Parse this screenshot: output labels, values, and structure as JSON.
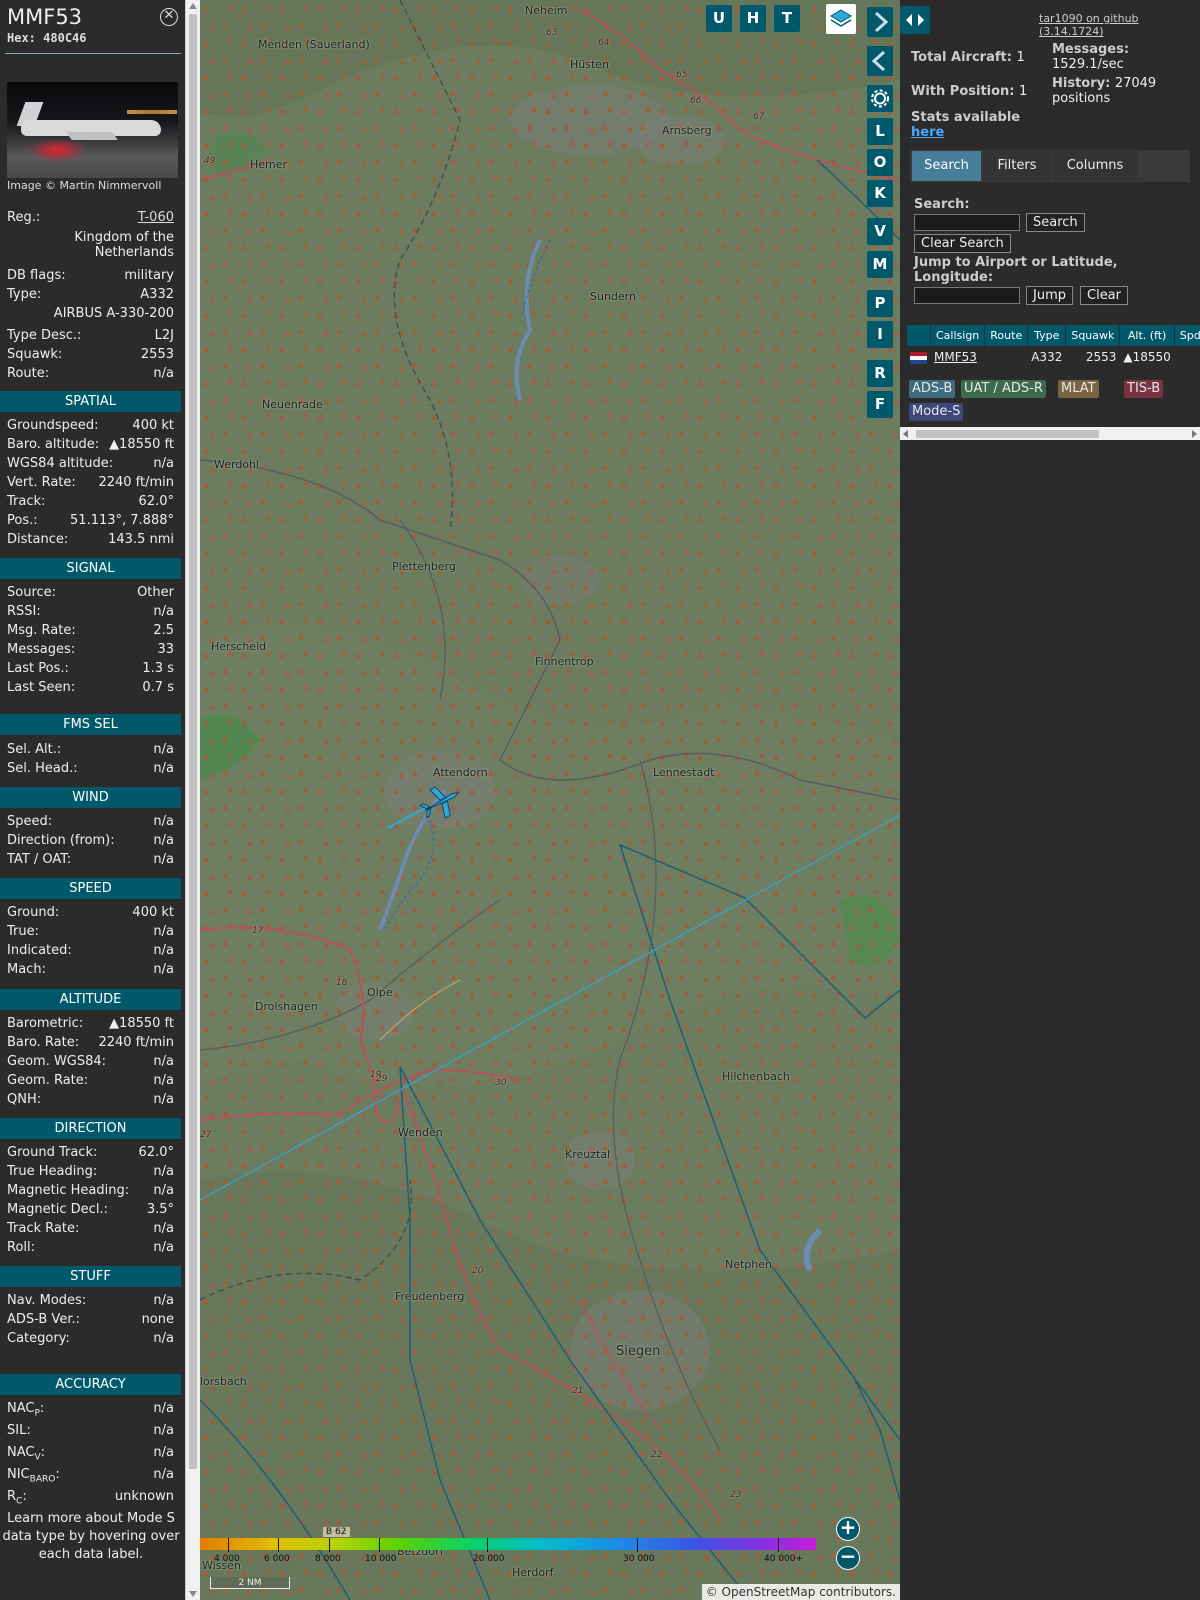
{
  "info": {
    "callsign": "MMF53",
    "hex_label": "Hex:",
    "hex": "480C46",
    "photo_credit": "Image © Martin Nimmervoll",
    "reg_label": "Reg.:",
    "reg": "T-060",
    "country": "Kingdom of the Netherlands",
    "dbflags_label": "DB flags:",
    "dbflags": "military",
    "type_label": "Type:",
    "type": "A332",
    "type_full": "AIRBUS A-330-200",
    "typedesc_label": "Type Desc.:",
    "typedesc": "L2J",
    "squawk_label": "Squawk:",
    "squawk": "2553",
    "route_label": "Route:",
    "route": "n/a",
    "sections": {
      "spatial": "SPATIAL",
      "signal": "SIGNAL",
      "fms": "FMS SEL",
      "wind": "WIND",
      "speed": "SPEED",
      "altitude": "ALTITUDE",
      "direction": "DIRECTION",
      "stuff": "STUFF",
      "accuracy": "ACCURACY"
    },
    "spatial": [
      {
        "label": "Groundspeed:",
        "value": "400 kt"
      },
      {
        "label": "Baro. altitude:",
        "value": "▲18550 ft"
      },
      {
        "label": "WGS84 altitude:",
        "value": "n/a"
      },
      {
        "label": "Vert. Rate:",
        "value": "2240 ft/min"
      },
      {
        "label": "Track:",
        "value": "62.0°"
      },
      {
        "label": "Pos.:",
        "value": "51.113°, 7.888°"
      },
      {
        "label": "Distance:",
        "value": "143.5 nmi"
      }
    ],
    "signal": [
      {
        "label": "Source:",
        "value": "Other"
      },
      {
        "label": "RSSI:",
        "value": "n/a"
      },
      {
        "label": "Msg. Rate:",
        "value": "2.5"
      },
      {
        "label": "Messages:",
        "value": "33"
      },
      {
        "label": "Last Pos.:",
        "value": "1.3 s"
      },
      {
        "label": "Last Seen:",
        "value": "0.7 s"
      }
    ],
    "fms": [
      {
        "label": "Sel. Alt.:",
        "value": "n/a"
      },
      {
        "label": "Sel. Head.:",
        "value": "n/a"
      }
    ],
    "wind": [
      {
        "label": "Speed:",
        "value": "n/a"
      },
      {
        "label": "Direction (from):",
        "value": "n/a"
      },
      {
        "label": "TAT / OAT:",
        "value": "n/a"
      }
    ],
    "speed": [
      {
        "label": "Ground:",
        "value": "400 kt"
      },
      {
        "label": "True:",
        "value": "n/a"
      },
      {
        "label": "Indicated:",
        "value": "n/a"
      },
      {
        "label": "Mach:",
        "value": "n/a"
      }
    ],
    "altitude": [
      {
        "label": "Barometric:",
        "value": "▲18550 ft"
      },
      {
        "label": "Baro. Rate:",
        "value": "2240 ft/min"
      },
      {
        "label": "Geom. WGS84:",
        "value": "n/a"
      },
      {
        "label": "Geom. Rate:",
        "value": "n/a"
      },
      {
        "label": "QNH:",
        "value": "n/a"
      }
    ],
    "direction": [
      {
        "label": "Ground Track:",
        "value": "62.0°"
      },
      {
        "label": "True Heading:",
        "value": "n/a"
      },
      {
        "label": "Magnetic Heading:",
        "value": "n/a"
      },
      {
        "label": "Magnetic Decl.:",
        "value": "3.5°"
      },
      {
        "label": "Track Rate:",
        "value": "n/a"
      },
      {
        "label": "Roll:",
        "value": "n/a"
      }
    ],
    "stuff": [
      {
        "label": "Nav. Modes:",
        "value": "n/a"
      },
      {
        "label": "ADS-B Ver.:",
        "value": "none"
      },
      {
        "label": "Category:",
        "value": "n/a"
      }
    ],
    "accuracy": [
      {
        "label": "NAC",
        "sub": "P",
        "value": "n/a"
      },
      {
        "label": "SIL:",
        "sub": "",
        "value": "n/a"
      },
      {
        "label": "NAC",
        "sub": "V",
        "value": "n/a"
      },
      {
        "label": "NIC",
        "sub": "BARO",
        "value": "n/a"
      },
      {
        "label": "R",
        "sub": "C",
        "value": "unknown"
      }
    ],
    "learn_more": "Learn more about Mode S data type by hovering over each data label."
  },
  "map": {
    "towns": [
      "Neheim",
      "Menden (Sauerland)",
      "Hüsten",
      "Hemer",
      "Arnsberg",
      "Sundern",
      "Neuenrade",
      "Werdohl",
      "Plettenberg",
      "Herscheid",
      "Finnentrop",
      "Attendorn",
      "Lennestadt",
      "Olpe",
      "Drolshagen",
      "Hilchenbach",
      "Wenden",
      "Kreuztal",
      "Netphen",
      "Freudenberg",
      "Siegen",
      "lorsbach",
      "Betzdorf",
      "Herdorf",
      "Wissen"
    ],
    "road_numbers": [
      "63",
      "64",
      "65",
      "66",
      "67",
      "49",
      "17",
      "18",
      "19",
      "29",
      "30",
      "20",
      "21",
      "22",
      "23",
      "27",
      "B 62"
    ],
    "top_buttons": [
      "U",
      "H",
      "T"
    ],
    "side_buttons": [
      "L",
      "O",
      "K",
      "V",
      "M",
      "P",
      "I",
      "R",
      "F"
    ],
    "layers_icon": "layers-icon",
    "settings_icon": "gear-icon",
    "colorbar_labels": [
      "4 000",
      "6 000",
      "8 000",
      "10 000",
      "20 000",
      "30 000",
      "40 000+"
    ],
    "scale": "2 NM",
    "attribution_prefix": "© ",
    "attribution_link": "OpenStreetMap",
    "attribution_suffix": " contributors."
  },
  "side": {
    "version_link": "tar1090 on github (3.14.1724)",
    "total_aircraft_label": "Total Aircraft:",
    "total_aircraft": "1",
    "with_position_label": "With Position:",
    "with_position": "1",
    "messages_label": "Messages:",
    "messages": "1529.1/sec",
    "history_label": "History:",
    "history": "27049",
    "history_unit": "positions",
    "stats_label": "Stats available",
    "stats_link": "here",
    "tabs": [
      "Search",
      "Filters",
      "Columns"
    ],
    "search_label": "Search:",
    "search_value": "",
    "search_button": "Search",
    "clear_search_button": "Clear Search",
    "jump_label": "Jump to Airport or Latitude, Longitude:",
    "jump_value": "",
    "jump_button": "Jump",
    "clear_button": "Clear",
    "table_headers": [
      "",
      "Callsign",
      "Route",
      "Type",
      "Squawk",
      "Alt. (ft)",
      "Spd"
    ],
    "table_rows": [
      {
        "flag": "flag-nl-icon",
        "callsign": "MMF53",
        "route": "",
        "type": "A332",
        "squawk": "2553",
        "alt": "▲18550",
        "spd": ""
      }
    ],
    "legend": [
      {
        "label": "ADS-B",
        "bg": "#3f6b7e",
        "fg": "#e8e8e8"
      },
      {
        "label": "UAT / ADS-R",
        "bg": "#3b6a4f",
        "fg": "#e8e8e8"
      },
      {
        "label": "MLAT",
        "bg": "#7a6443",
        "fg": "#e8e8e8"
      },
      {
        "label": "TIS-B",
        "bg": "#7a3340",
        "fg": "#e8e8e8"
      },
      {
        "label": "Mode-S",
        "bg": "#3d477a",
        "fg": "#e8e8e8"
      }
    ]
  },
  "colors": {
    "accent": "#00596b",
    "map_bg": "#687a5c",
    "aircraft": "#2fa8d8",
    "range_line": "#1a5f78"
  }
}
